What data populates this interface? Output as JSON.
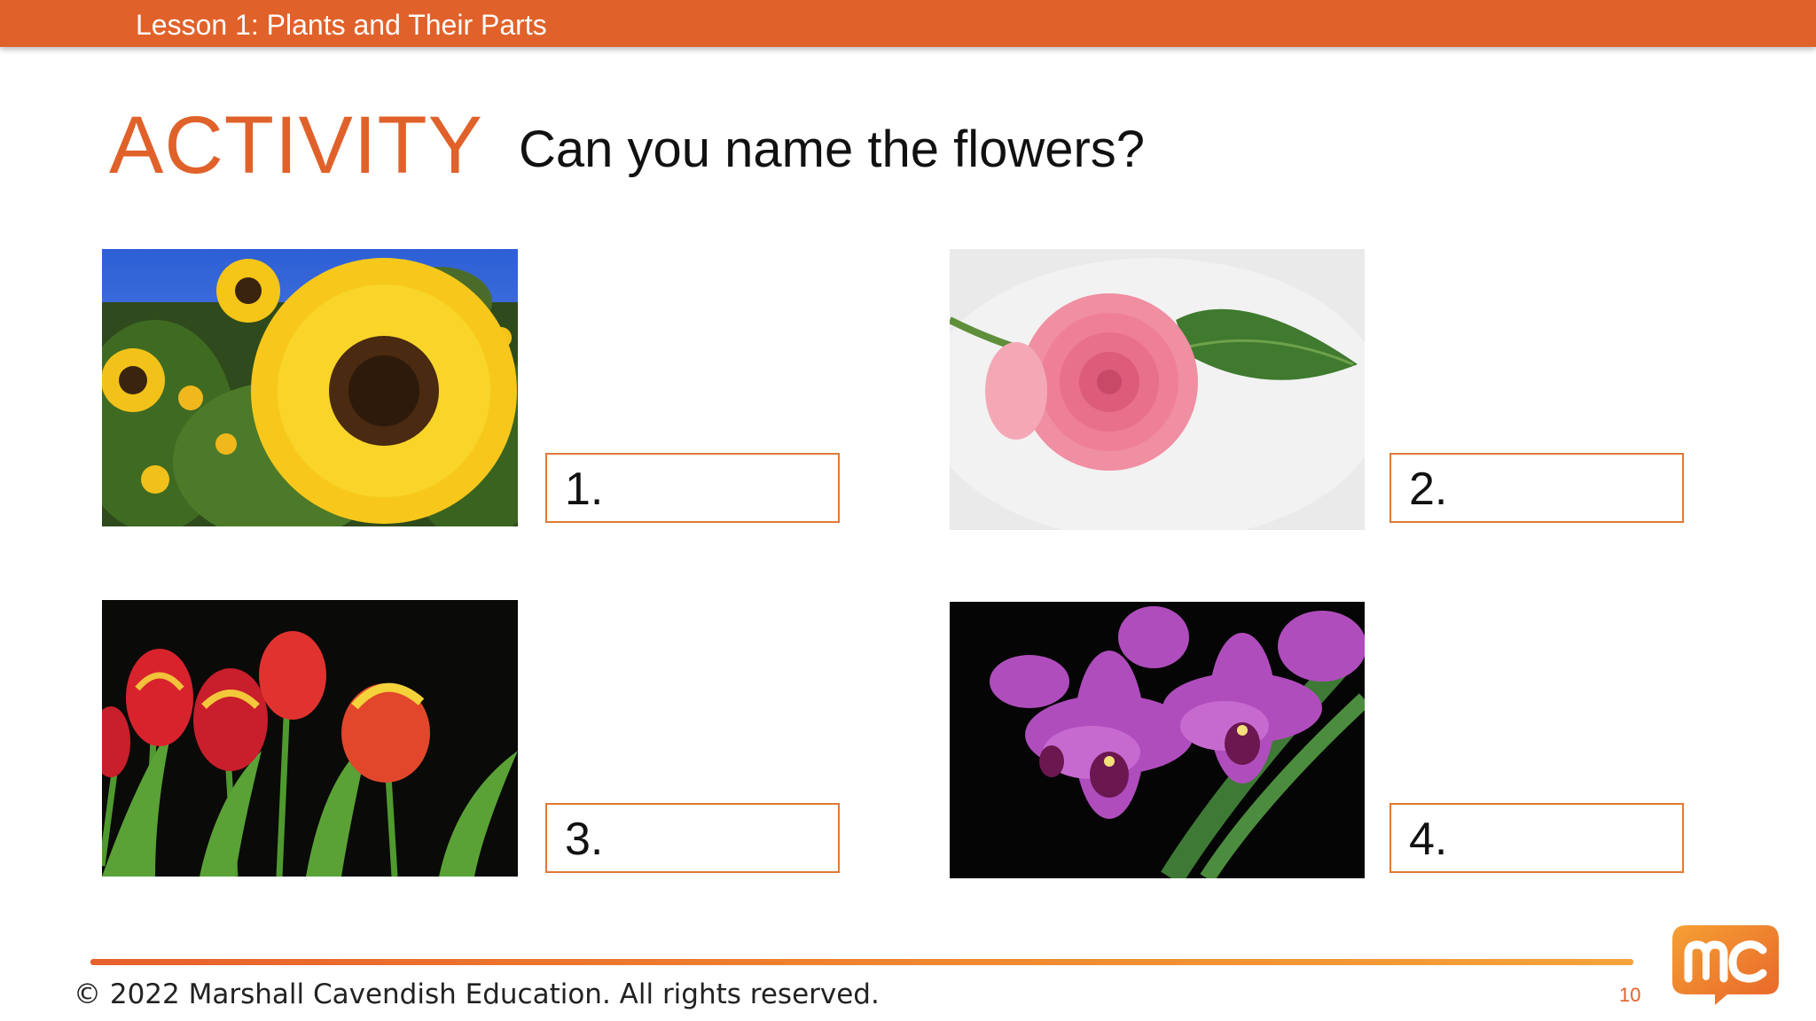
{
  "header": {
    "lesson_title": "Lesson 1: Plants and Their Parts"
  },
  "activity": {
    "label": "ACTIVITY",
    "question": "Can you name the flowers?"
  },
  "items": [
    {
      "number": "1.",
      "picture": "sunflower-photo"
    },
    {
      "number": "2.",
      "picture": "rose-photo"
    },
    {
      "number": "3.",
      "picture": "tulip-photo"
    },
    {
      "number": "4.",
      "picture": "orchid-photo"
    }
  ],
  "footer": {
    "copyright": "© 2022 Marshall Cavendish Education. All rights reserved.",
    "page_number": "10",
    "logo": "mc-logo"
  },
  "colors": {
    "accent": "#e0622a",
    "box_border": "#e07a35"
  }
}
